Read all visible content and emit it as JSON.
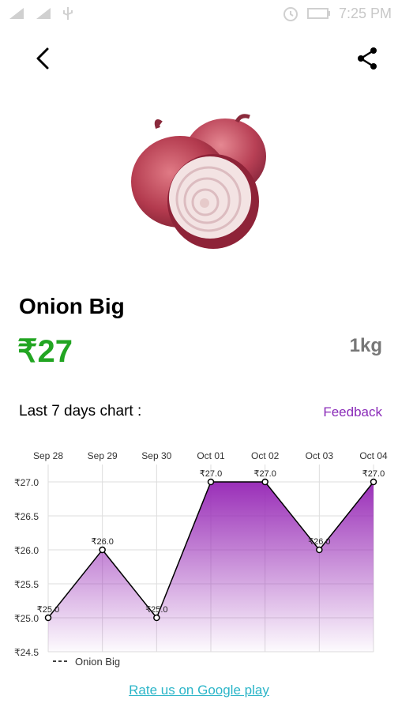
{
  "status_bar": {
    "time": "7:25 PM"
  },
  "product": {
    "name": "Onion Big",
    "price": "₹27",
    "unit": "1kg"
  },
  "chart_section": {
    "label": "Last 7 days chart :",
    "feedback": "Feedback"
  },
  "chart_data": {
    "type": "area",
    "categories": [
      "Sep 28",
      "Sep 29",
      "Sep 30",
      "Oct 01",
      "Oct 02",
      "Oct 03",
      "Oct 04"
    ],
    "series": [
      {
        "name": "Onion Big",
        "values": [
          25.0,
          26.0,
          25.0,
          27.0,
          27.0,
          26.0,
          27.0
        ]
      }
    ],
    "value_labels": [
      "₹25.0",
      "₹26.0",
      "₹25.0",
      "₹27.0",
      "₹27.0",
      "₹26.0",
      "₹27.0"
    ],
    "y_ticks": [
      24.5,
      25.0,
      25.5,
      26.0,
      26.5,
      27.0
    ],
    "y_tick_labels": [
      "₹24.5",
      "₹25.0",
      "₹25.5",
      "₹26.0",
      "₹26.5",
      "₹27.0"
    ],
    "ylim": [
      24.5,
      27.0
    ],
    "grid": true,
    "legend_position": "bottom-left",
    "fill_color": "#9a2fb8",
    "line_color": "#000000"
  },
  "footer": {
    "rate_link": "Rate us on Google play"
  }
}
